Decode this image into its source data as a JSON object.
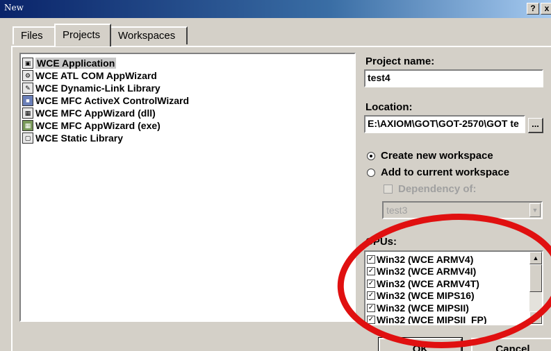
{
  "window": {
    "title": "New",
    "help_label": "?",
    "close_label": "x"
  },
  "tabs": [
    {
      "label": "Files"
    },
    {
      "label": "Projects"
    },
    {
      "label": "Workspaces"
    }
  ],
  "projects": {
    "items": [
      {
        "label": "WCE Application",
        "icon": "application-icon",
        "selected": true
      },
      {
        "label": "WCE ATL COM AppWizard",
        "icon": "atl-wizard-icon"
      },
      {
        "label": "WCE Dynamic-Link Library",
        "icon": "dll-icon"
      },
      {
        "label": "WCE MFC ActiveX ControlWizard",
        "icon": "activex-icon"
      },
      {
        "label": "WCE MFC AppWizard (dll)",
        "icon": "mfc-dll-icon"
      },
      {
        "label": "WCE MFC AppWizard (exe)",
        "icon": "mfc-exe-icon"
      },
      {
        "label": "WCE Static Library",
        "icon": "static-library-icon"
      }
    ]
  },
  "form": {
    "project_name_label": "Project name:",
    "project_name_value": "test4",
    "location_label": "Location:",
    "location_value": "E:\\AXIOM\\GOT\\GOT-2570\\GOT te",
    "browse_label": "...",
    "create_workspace_label": "Create new workspace",
    "add_workspace_label": "Add to current workspace",
    "dependency_label": "Dependency of:",
    "dependency_value": "test3",
    "cpus_label": "CPUs:"
  },
  "cpus": [
    {
      "label": "Win32 (WCE ARMV4)",
      "checked": true
    },
    {
      "label": "Win32 (WCE ARMV4I)",
      "checked": true
    },
    {
      "label": "Win32 (WCE ARMV4T)",
      "checked": true
    },
    {
      "label": "Win32 (WCE MIPS16)",
      "checked": true
    },
    {
      "label": "Win32 (WCE MIPSII)",
      "checked": true
    },
    {
      "label": "Win32 (WCE MIPSII_FP)",
      "checked": true
    }
  ],
  "buttons": {
    "ok_label": "OK",
    "cancel_label": "Cancel"
  },
  "colors": {
    "annotation": "#e01010",
    "dialog_face": "#d4d0c8",
    "title_bar": "#0a246a"
  }
}
